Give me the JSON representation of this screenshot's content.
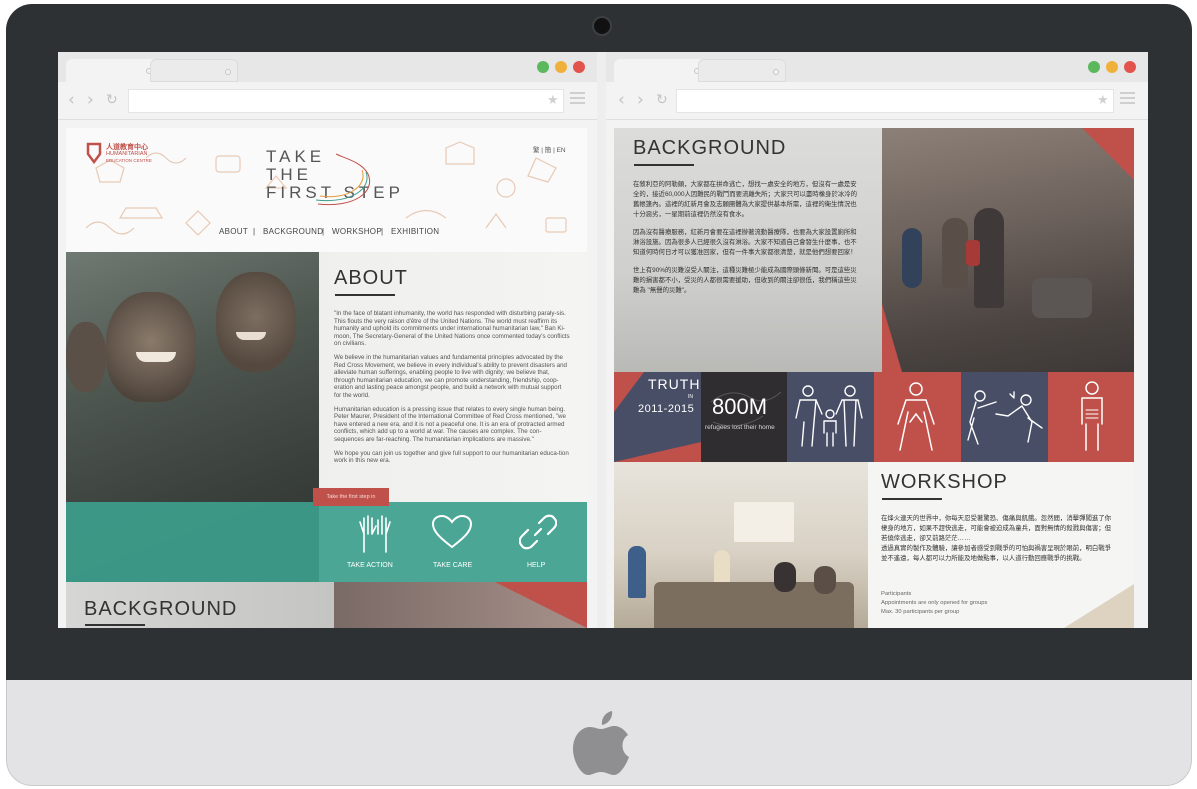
{
  "colors": {
    "red": "#c0504a",
    "teal": "#3d9e8c",
    "navy": "#474e66",
    "dark": "#2f2d2f",
    "monitor": "#2d3133"
  },
  "left_site": {
    "logo": {
      "zh": "人道教育中心",
      "en1": "HUMANITARIAN",
      "en2": "EDUCATION CENTRE"
    },
    "lang_switch": "繁 | 簡 | EN",
    "title_lines": [
      "TAKE",
      "THE",
      "FIRST STEP"
    ],
    "nav": [
      "ABOUT",
      "BACKGROUND",
      "WORKSHOP",
      "EXHIBITION"
    ],
    "nav_sep": "|",
    "about": {
      "heading": "ABOUT",
      "paragraphs": [
        "\"In the face of blatant inhumanity, the world has responded with disturbing paraly-sis. This flouts the very raison d'être of the United Nations. The world must reaffirm its humanity and uphold its commitments under international humanitarian law,\" Ban Ki-moon, The Secretary-General of the United Nations once commented today's conflicts on civilians.",
        "We believe in the humanitarian values and fundamental principles advocated by the Red Cross Movement, we believe in every individual's ability to prevent disasters and alleviate human sufferings, enabling people to live with dignity; we believe that, through humanitarian education, we can promote understanding, friendship, coop-eration and lasting peace amongst people, and build a network with mutual support for the world.",
        "Humanitarian education is a pressing issue that relates to every single human being. Peter Maurer, President of the International Committee of Red Cross mentioned, \"we have entered a new era, and it is not a peaceful one. It is an era of protracted armed conflicts, which add up to a world at war. The causes are complex. The con-sequences are far-reaching. The humanitarian implications are massive.\"",
        "We hope you can join us together and give full support to our humanitarian educa-tion work in this new era."
      ],
      "cta": "Take the first step in"
    },
    "actions": [
      {
        "label": "TAKE ACTION",
        "icon": "raised-hands-icon"
      },
      {
        "label": "TAKE CARE",
        "icon": "heart-icon"
      },
      {
        "label": "HELP",
        "icon": "chain-link-icon"
      }
    ],
    "next_heading": "BACKGROUND"
  },
  "right_site": {
    "background": {
      "heading": "BACKGROUND",
      "paragraphs": [
        "在敘利亞的阿勒頗，大家都在拼命逃亡，想找一處安全的地方，但沒有一處是安全的，接近60,000人因難民的戰鬥而要流離失所；大家只可以盡時橡身於冰冷的舊帳篷內。這裡的紅新月會及志願團體為大家提供基本所需，這裡的衛生情況也十分惡劣，一星期前這裡仍然沒有食水。",
        "因為沒有醫療服務，紅新月會要在這裡辦著流動醫療隊，也要為大家設置廁所和淋浴設施。因為很多人已經很久沒有淋浴。大家不知道自己會發生什麼事，也不知道何時何日才可以獲准回家，但有一件事大家都很清楚，就是他們想要回家！",
        "世上有90%的災難沒受人關注，這種災難極少能成為國際頭條新聞。可是這些災難的損害都不小，受災的人都很需要援助，但收到的關注卻很低，我們稱這些災難為 \"無聲的災難\"。"
      ]
    },
    "truth": {
      "label": "TRUTH",
      "in": "IN",
      "years": "2011-2015"
    },
    "stat": {
      "value": "800M",
      "caption": "refugees lost their home"
    },
    "stat_icons": [
      "family-icon",
      "person-icon",
      "fighting-figures-icon",
      "injured-person-icon"
    ],
    "workshop": {
      "heading": "WORKSHOP",
      "paragraphs": [
        "在烽火連天的世界中，你每天忍受著驚恐、傷痛與飢餓。忽然間，消擊彈闖進了你棲身的地方，如果不趕快逃走，可能會被迫成為童兵，面對無情的殺戮與傷害；但若僥倖逃走，卻又前路茫茫……",
        "透過真實的製作及體驗，讓參加者感受到戰爭的可怕與禍害呈現於眼前，明白戰爭並不遙遠，每人都可以力所能及地做點事，以人道行動回應戰爭的挑戰。"
      ],
      "participants": [
        "Participants",
        "Appointments are only opened for groups",
        "Max. 30 participants per group"
      ]
    }
  }
}
